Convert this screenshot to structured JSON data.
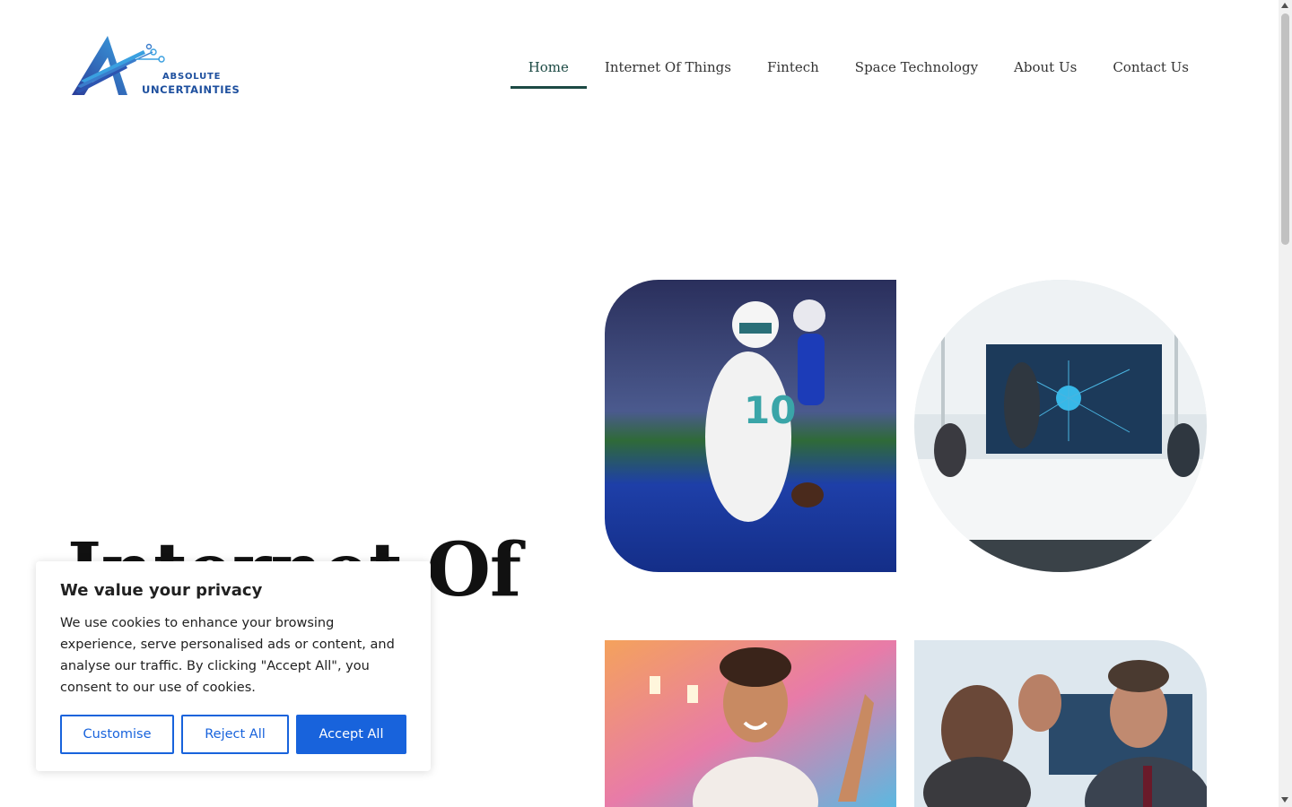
{
  "logo": {
    "line1": "ABSOLUTE",
    "line2": "UNCERTAINTIES"
  },
  "nav": {
    "items": [
      {
        "label": "Home",
        "active": true
      },
      {
        "label": "Internet Of Things",
        "active": false
      },
      {
        "label": "Fintech",
        "active": false
      },
      {
        "label": "Space Technology",
        "active": false
      },
      {
        "label": "About Us",
        "active": false
      },
      {
        "label": "Contact Us",
        "active": false
      }
    ]
  },
  "hero": {
    "title_visible": "Internet Of"
  },
  "tiles": [
    {
      "subject": "football player running with ball"
    },
    {
      "subject": "business meeting in front of IoT dashboard screen"
    },
    {
      "subject": "smiling woman with raised hand and candles"
    },
    {
      "subject": "professionals looking at a device"
    }
  ],
  "cookie": {
    "title": "We value your privacy",
    "text": "We use cookies to enhance your browsing experience, serve personalised ads or content, and analyse our traffic. By clicking \"Accept All\", you consent to our use of cookies.",
    "customise_label": "Customise",
    "reject_label": "Reject All",
    "accept_label": "Accept All"
  },
  "colors": {
    "brand_blue": "#1d4f9e",
    "nav_active": "#1c4a44",
    "cookie_button": "#1863dc"
  }
}
